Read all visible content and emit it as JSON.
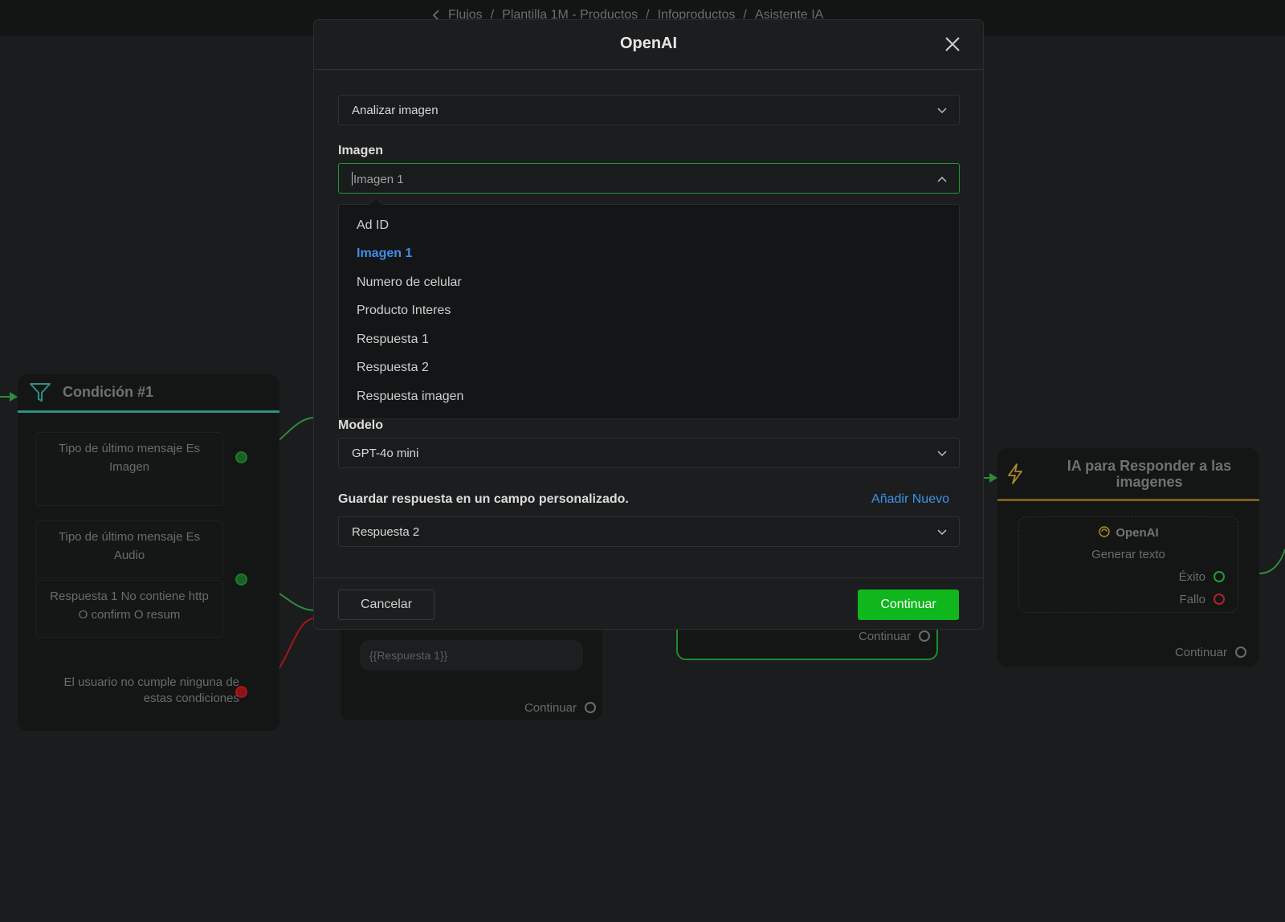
{
  "breadcrumb": {
    "items": [
      "Flujos",
      "Plantilla 1M - Productos",
      "Infoproductos",
      "Asistente IA"
    ],
    "separator": "/"
  },
  "canvas": {
    "condition_node": {
      "title": "Condición #1",
      "conditions": [
        {
          "field": "Tipo de último mensaje",
          "op": "Es",
          "value": "Imagen"
        },
        {
          "field": "Tipo de último mensaje",
          "op": "Es",
          "value": "Audio"
        },
        {
          "field": "Respuesta 1",
          "op": "No contiene",
          "value": "http",
          "extra": "O confirm O resum"
        }
      ],
      "fallback": "El usuario no cumple ninguna de estas condiciones"
    },
    "mid_node": {
      "input_value": "{{Respuesta 1}}",
      "continue_label": "Continuar"
    },
    "green_node": {
      "continue_label": "Continuar"
    },
    "ia_node": {
      "title": "IA para Responder a las imagenes",
      "action_title": "OpenAI",
      "action_subtitle": "Generar texto",
      "success_label": "Éxito",
      "fail_label": "Fallo",
      "continue_label": "Continuar"
    }
  },
  "modal": {
    "title": "OpenAI",
    "action_select": "Analizar imagen",
    "image_label": "Imagen",
    "image_input_value": "Imagen 1",
    "dropdown_options": [
      "Ad ID",
      "Imagen 1",
      "Numero de celular",
      "Producto Interes",
      "Respuesta 1",
      "Respuesta 2",
      "Respuesta imagen"
    ],
    "selected_option": "Imagen 1",
    "model_label": "Modelo",
    "model_value": "GPT-4o mini",
    "save_label": "Guardar respuesta en un campo personalizado.",
    "add_new_label": "Añadir Nuevo",
    "save_value": "Respuesta 2",
    "cancel_label": "Cancelar",
    "continue_label": "Continuar"
  },
  "colors": {
    "primary_green": "#0fb71c",
    "link_blue": "#3d92e8",
    "selected_option": "#3d8fe6",
    "background": "#1c1d1e"
  }
}
